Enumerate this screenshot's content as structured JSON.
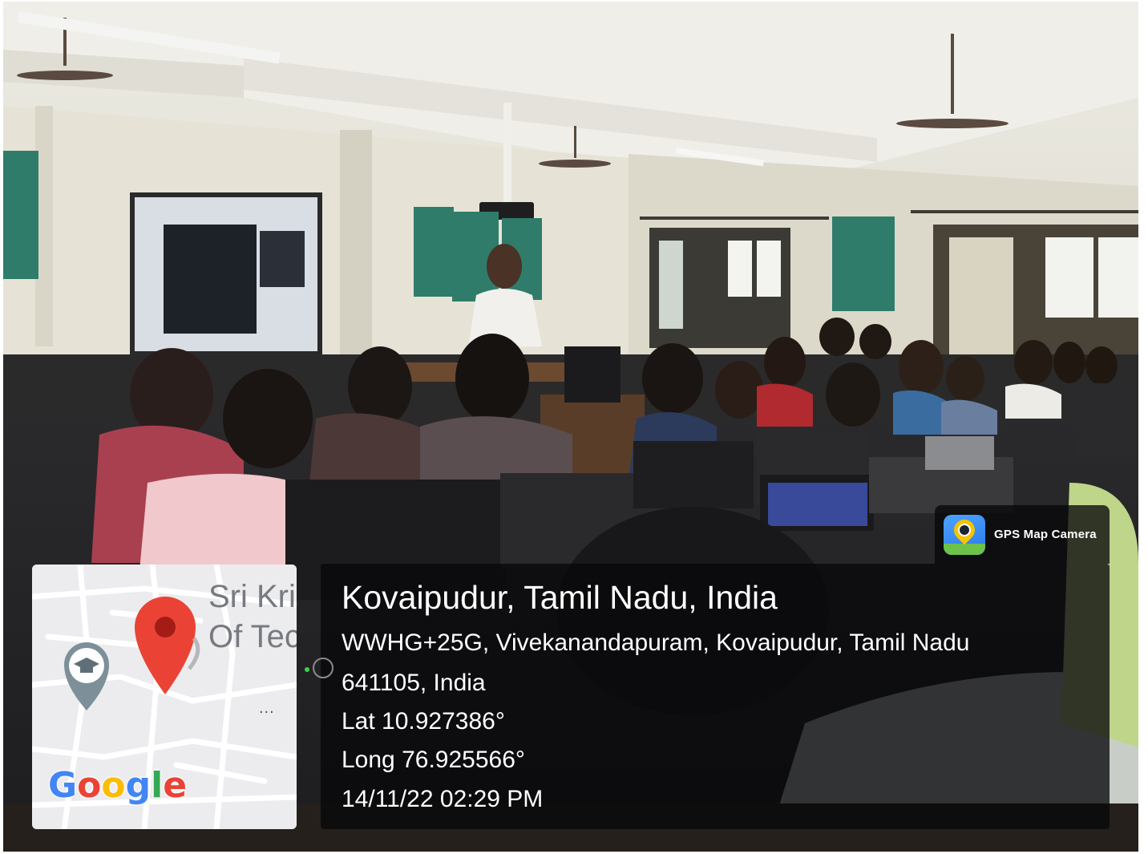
{
  "map": {
    "place_label_line1": "Sri Kri",
    "place_label_line2": "Of Tec",
    "more_dots": "...",
    "logo_letters": [
      "G",
      "o",
      "o",
      "g",
      "l",
      "e"
    ],
    "logo_colors": [
      "#4285F4",
      "#EA4335",
      "#FBBC05",
      "#4285F4",
      "#34A853",
      "#EA4335"
    ],
    "pin_color": "#EA4335",
    "school_pin_color": "#78909C"
  },
  "badge": {
    "app_name": "GPS Map Camera",
    "icon": "gps-map-camera-icon"
  },
  "location": {
    "title": "Kovaipudur, Tamil Nadu, India",
    "address_line1": "WWHG+25G, Vivekanandapuram, Kovaipudur, Tamil Nadu",
    "address_line2": "641105, India",
    "latitude": "Lat 10.927386°",
    "longitude": "Long 76.925566°",
    "timestamp": "14/11/22 02:29 PM"
  }
}
